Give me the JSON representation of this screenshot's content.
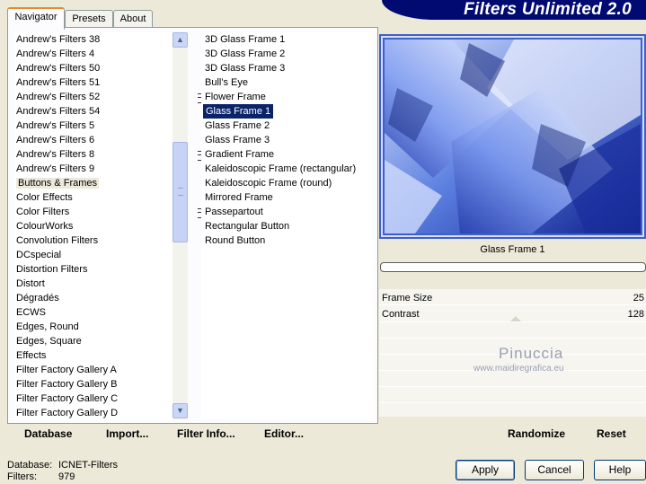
{
  "tabs": [
    {
      "label": "Navigator",
      "active": true
    },
    {
      "label": "Presets",
      "active": false
    },
    {
      "label": "About",
      "active": false
    }
  ],
  "app_title": "Filters Unlimited 2.0",
  "categories": [
    "Andrew's Filters 38",
    "Andrew's Filters 4",
    "Andrew's Filters 50",
    "Andrew's Filters 51",
    "Andrew's Filters 52",
    "Andrew's Filters 54",
    "Andrew's Filters 5",
    "Andrew's Filters 6",
    "Andrew's Filters 8",
    "Andrew's Filters 9",
    "Buttons & Frames",
    "Color Effects",
    "Color Filters",
    "ColourWorks",
    "Convolution Filters",
    "DCspecial",
    "Distortion Filters",
    "Distort",
    "Dégradés",
    "ECWS",
    "Edges, Round",
    "Edges, Square",
    "Effects",
    "Filter Factory Gallery A",
    "Filter Factory Gallery B",
    "Filter Factory Gallery C",
    "Filter Factory Gallery D"
  ],
  "categories_highlighted": "Buttons & Frames",
  "filters": [
    {
      "label": "3D Glass Frame 1",
      "grip": false
    },
    {
      "label": "3D Glass Frame 2",
      "grip": false
    },
    {
      "label": "3D Glass Frame 3",
      "grip": false
    },
    {
      "label": "Bull's Eye",
      "grip": false
    },
    {
      "label": "Flower Frame",
      "grip": true
    },
    {
      "label": "Glass Frame 1",
      "grip": false,
      "selected": true
    },
    {
      "label": "Glass Frame 2",
      "grip": false
    },
    {
      "label": "Glass Frame 3",
      "grip": false
    },
    {
      "label": "Gradient Frame",
      "grip": true
    },
    {
      "label": "Kaleidoscopic Frame (rectangular)",
      "grip": false
    },
    {
      "label": "Kaleidoscopic Frame (round)",
      "grip": false
    },
    {
      "label": "Mirrored Frame",
      "grip": false
    },
    {
      "label": "Passepartout",
      "grip": true
    },
    {
      "label": "Rectangular Button",
      "grip": false
    },
    {
      "label": "Round Button",
      "grip": false
    }
  ],
  "toolbar": {
    "database": "Database",
    "import": "Import...",
    "filter_info": "Filter Info...",
    "editor": "Editor..."
  },
  "preview": {
    "filter_name": "Glass Frame 1"
  },
  "params": [
    {
      "label": "Frame Size",
      "value": "25"
    },
    {
      "label": "Contrast",
      "value": "128"
    }
  ],
  "watermark": {
    "line1": "Pinuccia",
    "line2": "www.maidiregrafica.eu"
  },
  "actions": {
    "randomize": "Randomize",
    "reset": "Reset"
  },
  "status": {
    "database_label": "Database:",
    "database_value": "ICNET-Filters",
    "filters_label": "Filters:",
    "filters_value": "979"
  },
  "buttons": {
    "apply": "Apply",
    "cancel": "Cancel",
    "help": "Help"
  },
  "colors": {
    "banner": "#000a70",
    "selection": "#0a246a",
    "accent_tab": "#e68b2c"
  }
}
